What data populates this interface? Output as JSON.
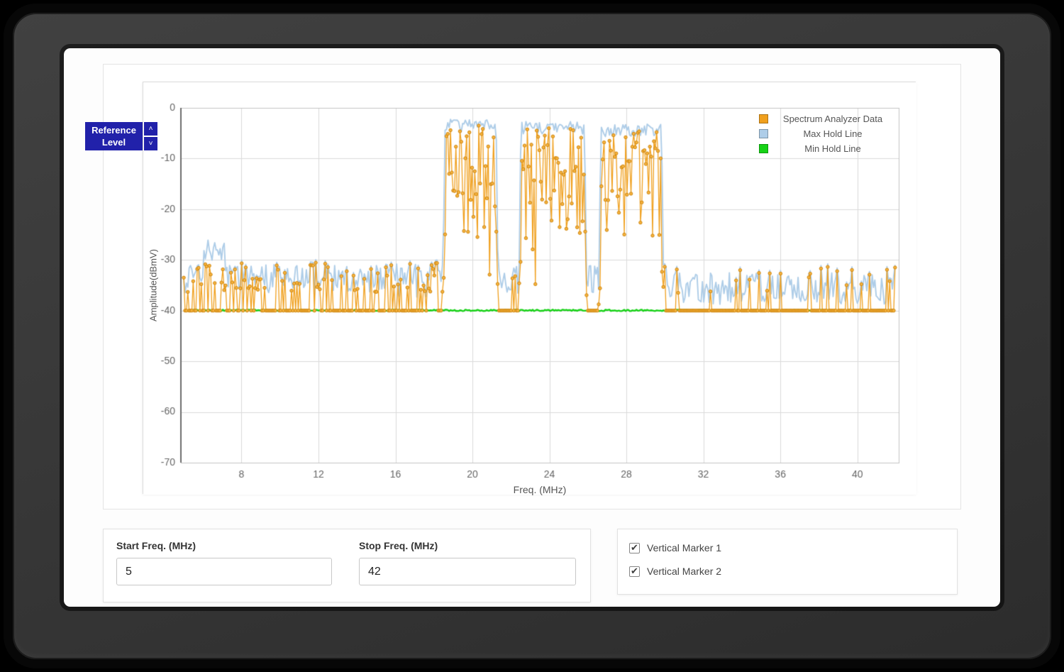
{
  "reference_level": {
    "label": "Reference Level",
    "up_icon": "˄",
    "down_icon": "˅"
  },
  "controls": {
    "start_freq": {
      "label": "Start Freq. (MHz)",
      "value": "5"
    },
    "stop_freq": {
      "label": "Stop Freq. (MHz)",
      "value": "42"
    },
    "markers": [
      {
        "label": "Vertical Marker 1",
        "checked": true
      },
      {
        "label": "Vertical Marker 2",
        "checked": true
      }
    ]
  },
  "chart_data": {
    "type": "line",
    "title": "",
    "xlabel": "Freq. (MHz)",
    "ylabel": "Amplitude(dBmV)",
    "xlim": [
      4.85,
      42.15
    ],
    "ylim": [
      -70,
      0
    ],
    "x_ticks": [
      8,
      12,
      16,
      20,
      24,
      28,
      32,
      36,
      40
    ],
    "y_ticks": [
      0,
      -10,
      -20,
      -30,
      -40,
      -50,
      -60,
      -70
    ],
    "grid": true,
    "legend_position": "top-right",
    "series": [
      {
        "name": "Spectrum Analyzer Data",
        "type": "stem-markers",
        "color": "#f0a01e",
        "marker_fill": "#f6b33e",
        "marker_edge": "#cf860e"
      },
      {
        "name": "Max Hold Line",
        "type": "line",
        "color": "#aecde8"
      },
      {
        "name": "Min Hold Line",
        "type": "line",
        "color": "#16d216"
      }
    ],
    "noise_floor_dbmv": -40,
    "min_hold_dbmv": -40,
    "noise_band_dbmv": [
      -38,
      -30
    ],
    "signal_bursts": [
      {
        "start_mhz": 18.45,
        "end_mhz": 21.35,
        "peak_dbmv": -3.5
      },
      {
        "start_mhz": 22.4,
        "end_mhz": 25.95,
        "peak_dbmv": -4.0
      },
      {
        "start_mhz": 26.55,
        "end_mhz": 29.95,
        "peak_dbmv": -4.5
      }
    ]
  }
}
